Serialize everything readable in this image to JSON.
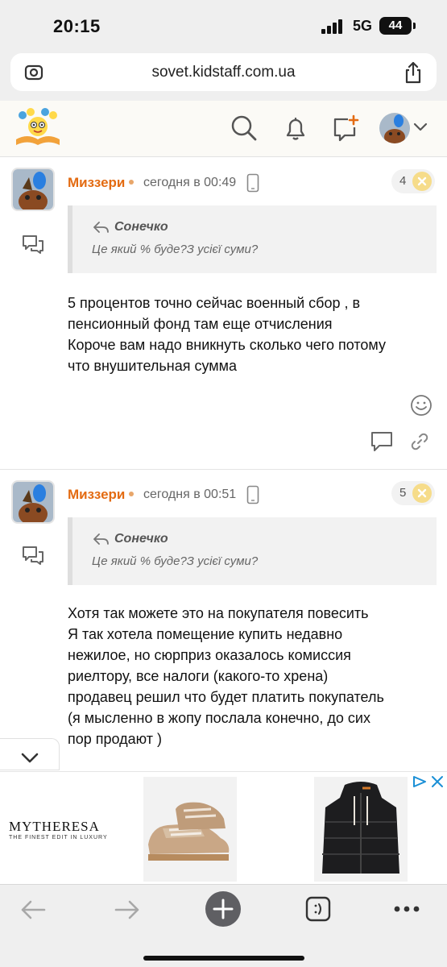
{
  "status_bar": {
    "time": "20:15",
    "network": "5G",
    "battery": "44"
  },
  "browser": {
    "url": "sovet.kidstaff.com.ua"
  },
  "posts": [
    {
      "author": "Миззери",
      "time": "сегодня в 00:49",
      "number": "4",
      "quote": {
        "author": "Сонечко",
        "text": "Це який % буде?З усієї суми?"
      },
      "lines": [
        "5 процентов точно сейчас военный сбор , в",
        "пенсионный фонд там еще отчисления",
        "Короче вам надо вникнуть сколько чего потому",
        "что внушительная сумма"
      ]
    },
    {
      "author": "Миззери",
      "time": "сегодня в 00:51",
      "number": "5",
      "quote": {
        "author": "Сонечко",
        "text": "Це який % буде?З усієї суми?"
      },
      "lines": [
        "Хотя так можете это на покупателя повесить",
        "Я так хотела помещение купить недавно",
        "нежилое, но сюрприз оказалось комиссия",
        "риелтору, все налоги (какого-то хрена)",
        "продавец решил что будет платить покупатель",
        "(я мысленно в жопу послала конечно, до сих",
        "пор продают )"
      ]
    }
  ],
  "ad": {
    "brand": "MYTHERESA",
    "tagline": "THE FINEST EDIT IN LUXURY"
  },
  "colors": {
    "author": "#e36b12",
    "badge_x": "#f6dc8a",
    "chrome": "#efefef"
  }
}
